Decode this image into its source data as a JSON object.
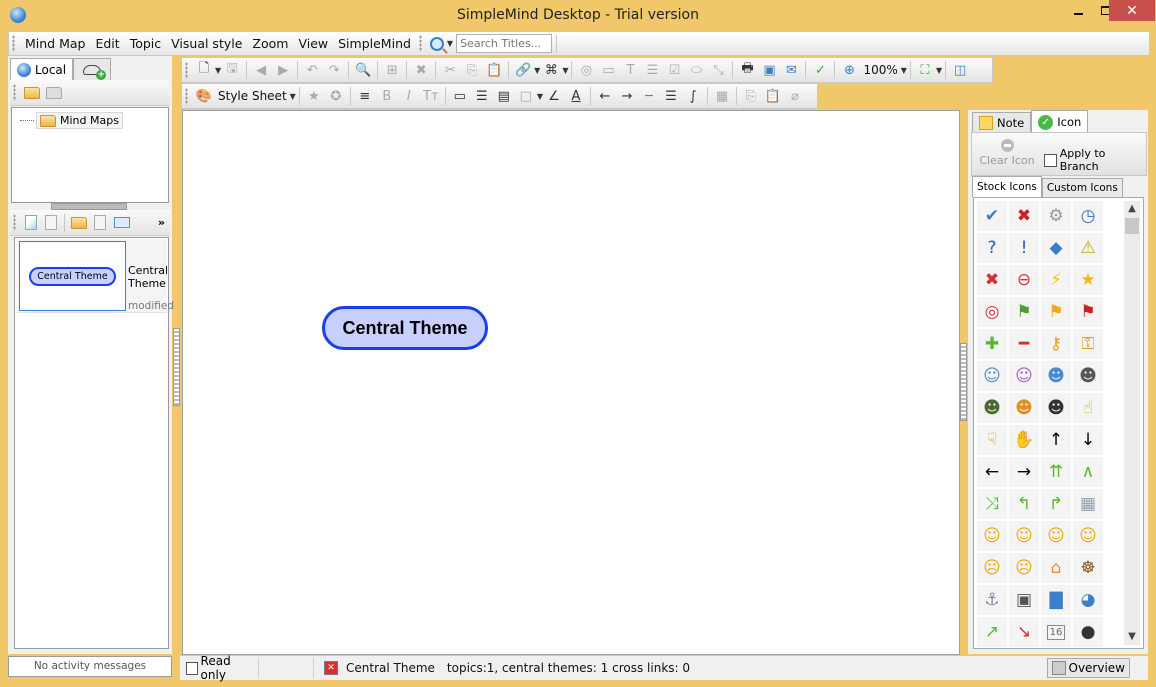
{
  "window": {
    "title": "SimpleMind Desktop - Trial version",
    "controls": {
      "minimize": "minimize",
      "maximize": "maximize",
      "close": "✕"
    }
  },
  "menubar": {
    "items": [
      "Mind Map",
      "Edit",
      "Topic",
      "Visual style",
      "Zoom",
      "View",
      "SimpleMind"
    ],
    "search_placeholder": "Search Titles..."
  },
  "left_panel": {
    "tabs": [
      {
        "label": "Local",
        "icon": "globe-icon",
        "active": true
      },
      {
        "label": "",
        "icon": "cloud-add-icon",
        "active": false
      }
    ],
    "tree": {
      "root_label": "Mind Maps"
    },
    "maps": [
      {
        "thumbnail_label": "Central Theme",
        "title": "Central Theme",
        "meta": "modified"
      }
    ],
    "more": "»",
    "activity": "No activity messages"
  },
  "toolbar": {
    "row1": {
      "zoom_level": "100%"
    },
    "row2": {
      "style_sheet_label": "Style Sheet"
    }
  },
  "canvas": {
    "central_theme": "Central Theme"
  },
  "right_panel": {
    "tabs": [
      {
        "label": "Note",
        "active": false
      },
      {
        "label": "Icon",
        "active": true
      }
    ],
    "clear_icon_label": "Clear Icon",
    "apply_to_branch_label": "Apply to Branch",
    "apply_to_branch_checked": false,
    "subtabs": [
      {
        "label": "Stock Icons",
        "active": true
      },
      {
        "label": "Custom Icons",
        "active": false
      }
    ],
    "icons": [
      {
        "name": "check",
        "glyph": "✔",
        "color": "#3c7ec8"
      },
      {
        "name": "cross",
        "glyph": "✖",
        "color": "#d02020"
      },
      {
        "name": "gear",
        "glyph": "⚙",
        "color": "#999999"
      },
      {
        "name": "clock",
        "glyph": "◷",
        "color": "#2c6cc0"
      },
      {
        "name": "question",
        "glyph": "?",
        "color": "#2c5cb8"
      },
      {
        "name": "exclamation",
        "glyph": "!",
        "color": "#2c5cb8"
      },
      {
        "name": "info",
        "glyph": "◆",
        "color": "#3c7ec8"
      },
      {
        "name": "warning",
        "glyph": "⚠",
        "color": "#c8a800"
      },
      {
        "name": "stop",
        "glyph": "✖",
        "color": "#d83030"
      },
      {
        "name": "no-entry",
        "glyph": "⊖",
        "color": "#d83030"
      },
      {
        "name": "lightning",
        "glyph": "⚡",
        "color": "#f0c020"
      },
      {
        "name": "star",
        "glyph": "★",
        "color": "#f0b820"
      },
      {
        "name": "target",
        "glyph": "◎",
        "color": "#d83030"
      },
      {
        "name": "flag-green",
        "glyph": "⚑",
        "color": "#4aa030"
      },
      {
        "name": "flag-orange",
        "glyph": "⚑",
        "color": "#f0a820"
      },
      {
        "name": "flag-red",
        "glyph": "⚑",
        "color": "#c82020"
      },
      {
        "name": "plus",
        "glyph": "✚",
        "color": "#5ab830"
      },
      {
        "name": "minus",
        "glyph": "━",
        "color": "#d03030"
      },
      {
        "name": "key",
        "glyph": "⚷",
        "color": "#e0a020"
      },
      {
        "name": "lock",
        "glyph": "⚿",
        "color": "#d8a020"
      },
      {
        "name": "user-male",
        "glyph": "☺",
        "color": "#4a8ad0"
      },
      {
        "name": "user-female",
        "glyph": "☺",
        "color": "#a060c0"
      },
      {
        "name": "users",
        "glyph": "☻",
        "color": "#4a8ad0"
      },
      {
        "name": "businessman",
        "glyph": "☻",
        "color": "#555555"
      },
      {
        "name": "soldier",
        "glyph": "☻",
        "color": "#4a6a30"
      },
      {
        "name": "worker",
        "glyph": "☻",
        "color": "#e09020"
      },
      {
        "name": "graduate",
        "glyph": "☻",
        "color": "#333333"
      },
      {
        "name": "thumbs-up",
        "glyph": "☝",
        "color": "#e0a020"
      },
      {
        "name": "thumbs-down",
        "glyph": "☟",
        "color": "#e0a020"
      },
      {
        "name": "handshake",
        "glyph": "✋",
        "color": "#e0a020"
      },
      {
        "name": "arrow-up",
        "glyph": "↑",
        "color": "#000000"
      },
      {
        "name": "arrow-down",
        "glyph": "↓",
        "color": "#000000"
      },
      {
        "name": "arrow-left",
        "glyph": "←",
        "color": "#000000"
      },
      {
        "name": "arrow-right",
        "glyph": "→",
        "color": "#000000"
      },
      {
        "name": "split",
        "glyph": "⇈",
        "color": "#5ab830"
      },
      {
        "name": "merge",
        "glyph": "∧",
        "color": "#5ab830"
      },
      {
        "name": "shuffle",
        "glyph": "⤨",
        "color": "#5ab830"
      },
      {
        "name": "turn-left",
        "glyph": "↰",
        "color": "#5ab830"
      },
      {
        "name": "turn-right",
        "glyph": "↱",
        "color": "#5ab830"
      },
      {
        "name": "wall",
        "glyph": "▦",
        "color": "#8aa0b8"
      },
      {
        "name": "smile",
        "glyph": "☺",
        "color": "#f0a800"
      },
      {
        "name": "laugh",
        "glyph": "☺",
        "color": "#f0a800"
      },
      {
        "name": "wink",
        "glyph": "☺",
        "color": "#f0a800"
      },
      {
        "name": "surprised",
        "glyph": "☺",
        "color": "#f0a800"
      },
      {
        "name": "sad",
        "glyph": "☹",
        "color": "#f0a800"
      },
      {
        "name": "cry",
        "glyph": "☹",
        "color": "#f0a800"
      },
      {
        "name": "cake",
        "glyph": "⌂",
        "color": "#e89040"
      },
      {
        "name": "ship-wheel",
        "glyph": "☸",
        "color": "#8a5a20"
      },
      {
        "name": "anchor",
        "glyph": "⚓",
        "color": "#7a8a9a"
      },
      {
        "name": "binoculars",
        "glyph": "▣",
        "color": "#555555"
      },
      {
        "name": "bar-chart",
        "glyph": "▇",
        "color": "#3c7ec8"
      },
      {
        "name": "pie-chart",
        "glyph": "◕",
        "color": "#3c7ec8"
      },
      {
        "name": "trend-up",
        "glyph": "↗",
        "color": "#5ab830"
      },
      {
        "name": "trend-down",
        "glyph": "↘",
        "color": "#d03030"
      },
      {
        "name": "calendar",
        "glyph": "16",
        "color": "#666666"
      },
      {
        "name": "bomb",
        "glyph": "●",
        "color": "#333333"
      }
    ]
  },
  "statusbar": {
    "read_only_label": "Read only",
    "read_only_checked": false,
    "theme_name": "Central Theme",
    "stats": "topics:1, central themes: 1 cross links: 0",
    "overview_label": "Overview"
  }
}
